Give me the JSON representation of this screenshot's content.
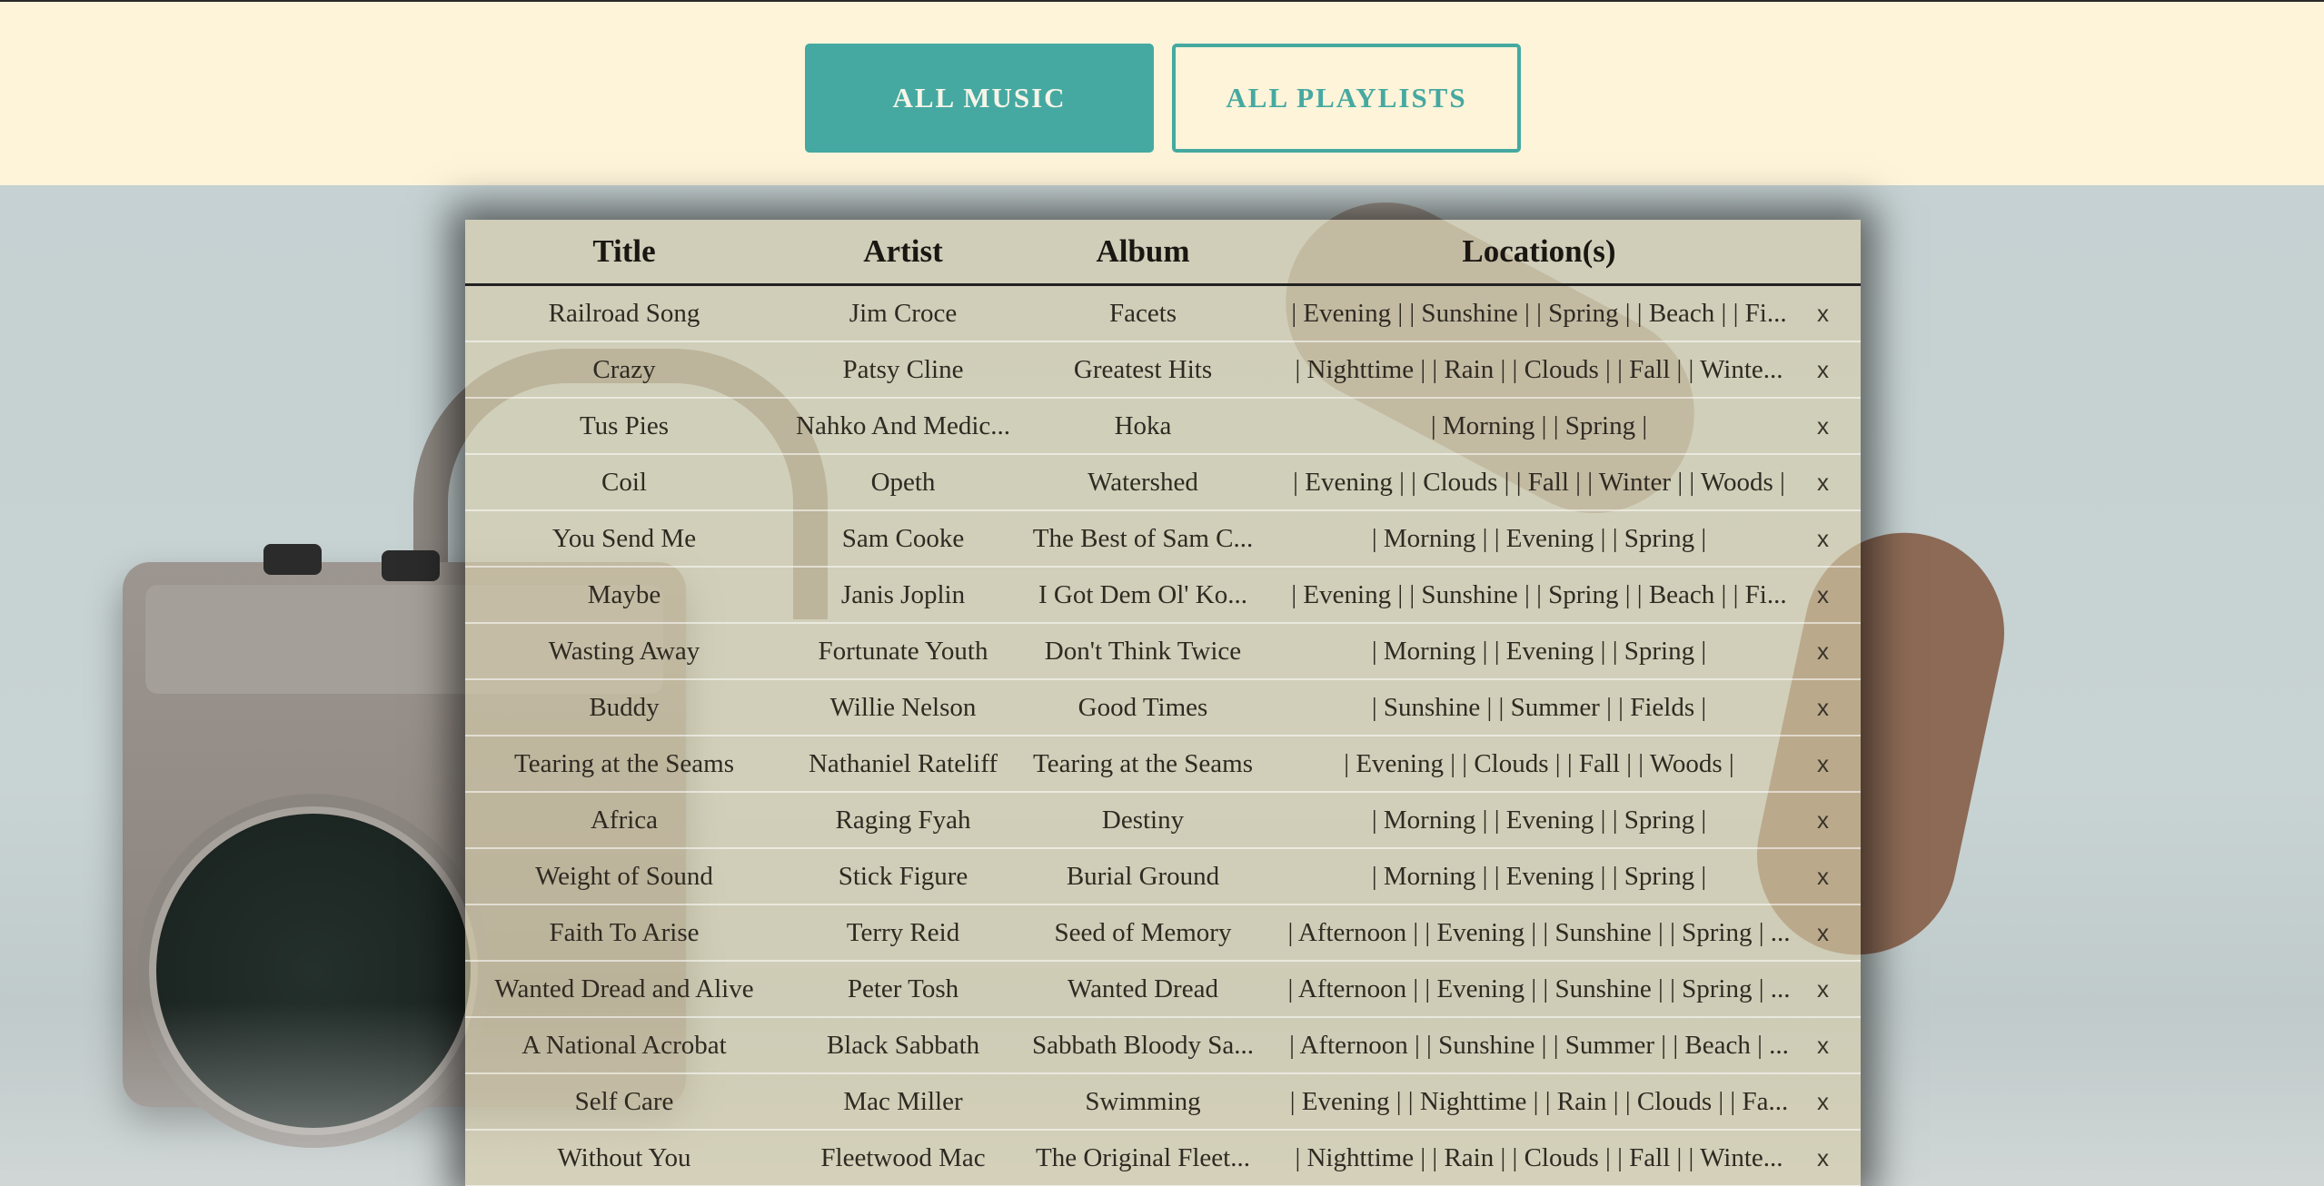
{
  "nav": {
    "all_music_label": "ALL MUSIC",
    "all_playlists_label": "ALL PLAYLISTS"
  },
  "table": {
    "headers": [
      "Title",
      "Artist",
      "Album",
      "Location(s)"
    ],
    "delete_label": "x",
    "rows": [
      {
        "title": "Railroad Song",
        "artist": "Jim Croce",
        "album": "Facets",
        "locations": "| Evening | | Sunshine | | Spring | | Beach | | Fi..."
      },
      {
        "title": "Crazy",
        "artist": "Patsy Cline",
        "album": "Greatest Hits",
        "locations": "| Nighttime | | Rain | | Clouds | | Fall | | Winte..."
      },
      {
        "title": "Tus Pies",
        "artist": "Nahko And Medic...",
        "album": "Hoka",
        "locations": "| Morning | | Spring |"
      },
      {
        "title": "Coil",
        "artist": "Opeth",
        "album": "Watershed",
        "locations": "| Evening | | Clouds | | Fall | | Winter | | Woods |"
      },
      {
        "title": "You Send Me",
        "artist": "Sam Cooke",
        "album": "The Best of Sam C...",
        "locations": "| Morning | | Evening | | Spring |"
      },
      {
        "title": "Maybe",
        "artist": "Janis Joplin",
        "album": "I Got Dem Ol' Ko...",
        "locations": "| Evening | | Sunshine | | Spring | | Beach | | Fi..."
      },
      {
        "title": "Wasting Away",
        "artist": "Fortunate Youth",
        "album": "Don't Think Twice",
        "locations": "| Morning | | Evening | | Spring |"
      },
      {
        "title": "Buddy",
        "artist": "Willie Nelson",
        "album": "Good Times",
        "locations": "| Sunshine | | Summer | | Fields |"
      },
      {
        "title": "Tearing at the Seams",
        "artist": "Nathaniel Rateliff",
        "album": "Tearing at the Seams",
        "locations": "| Evening | | Clouds | | Fall | | Woods |"
      },
      {
        "title": "Africa",
        "artist": "Raging Fyah",
        "album": "Destiny",
        "locations": "| Morning | | Evening | | Spring |"
      },
      {
        "title": "Weight of Sound",
        "artist": "Stick Figure",
        "album": "Burial Ground",
        "locations": "| Morning | | Evening | | Spring |"
      },
      {
        "title": "Faith To Arise",
        "artist": "Terry Reid",
        "album": "Seed of Memory",
        "locations": "| Afternoon | | Evening | | Sunshine | | Spring | ..."
      },
      {
        "title": "Wanted Dread and Alive",
        "artist": "Peter Tosh",
        "album": "Wanted Dread",
        "locations": "| Afternoon | | Evening | | Sunshine | | Spring | ..."
      },
      {
        "title": "A National Acrobat",
        "artist": "Black Sabbath",
        "album": "Sabbath Bloody Sa...",
        "locations": "| Afternoon | | Sunshine | | Summer | | Beach | ..."
      },
      {
        "title": "Self Care",
        "artist": "Mac Miller",
        "album": "Swimming",
        "locations": "| Evening | | Nighttime | | Rain | | Clouds | | Fa..."
      },
      {
        "title": "Without You",
        "artist": "Fleetwood Mac",
        "album": "The Original Fleet...",
        "locations": "| Nighttime | | Rain | | Clouds | | Fall | | Winte..."
      }
    ]
  }
}
